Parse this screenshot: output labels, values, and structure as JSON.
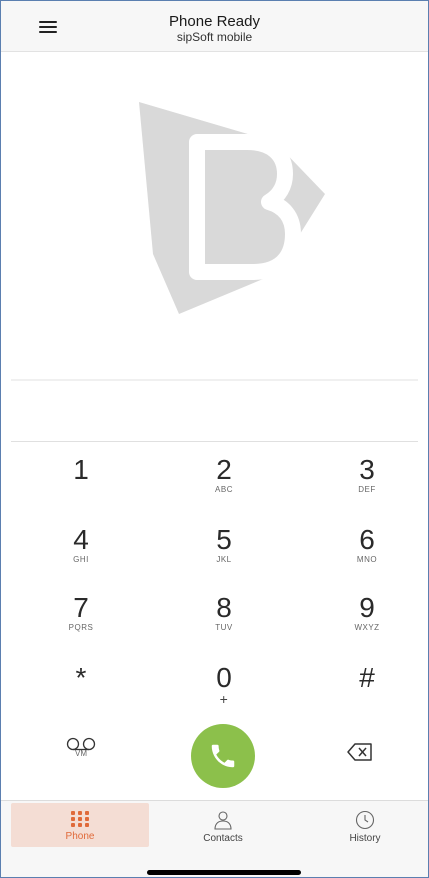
{
  "header": {
    "title": "Phone Ready",
    "subtitle": "sipSoft mobile"
  },
  "logo": {
    "letter": "B",
    "color": "#d9d9d9"
  },
  "dialer": {
    "number": "",
    "keys": [
      {
        "digit": "1",
        "letters": ""
      },
      {
        "digit": "2",
        "letters": "ABC"
      },
      {
        "digit": "3",
        "letters": "DEF"
      },
      {
        "digit": "4",
        "letters": "GHI"
      },
      {
        "digit": "5",
        "letters": "JKL"
      },
      {
        "digit": "6",
        "letters": "MNO"
      },
      {
        "digit": "7",
        "letters": "PQRS"
      },
      {
        "digit": "8",
        "letters": "TUV"
      },
      {
        "digit": "9",
        "letters": "WXYZ"
      },
      {
        "digit": "*",
        "letters": ""
      },
      {
        "digit": "0",
        "letters": "+"
      },
      {
        "digit": "#",
        "letters": ""
      }
    ],
    "voicemail_label": "VM",
    "call_color": "#8cc04b"
  },
  "tabs": [
    {
      "label": "Phone",
      "icon": "keypad-grid-icon",
      "active": true
    },
    {
      "label": "Contacts",
      "icon": "person-icon",
      "active": false
    },
    {
      "label": "History",
      "icon": "clock-icon",
      "active": false
    }
  ],
  "colors": {
    "accent": "#e06a3a",
    "active_tab_bg": "#f4ddd4"
  }
}
